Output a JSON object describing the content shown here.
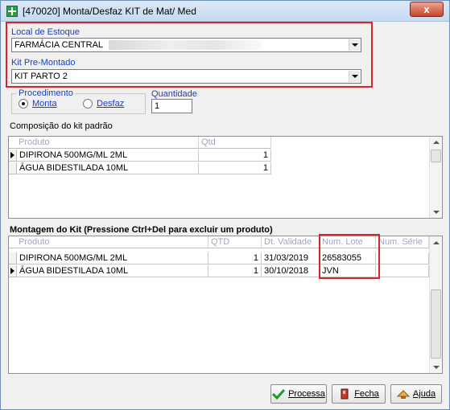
{
  "window": {
    "title": "[470020]  Monta/Desfaz KIT de Mat/ Med",
    "close_label": "x"
  },
  "form": {
    "local_estoque_label": "Local de Estoque",
    "local_estoque_value": "FARMÁCIA CENTRAL",
    "kit_label": "Kit Pre-Montado",
    "kit_value": "KIT PARTO 2",
    "procedimento_label": "Procedimento",
    "radio_monta": "Monta",
    "radio_desfaz": "Desfaz",
    "selected_procedimento": "Monta",
    "quantidade_label": "Quantidade",
    "quantidade_value": "1"
  },
  "composicao": {
    "title": "Composição do kit padrão",
    "columns": [
      "Produto",
      "Qtd"
    ],
    "rows": [
      {
        "produto": "DIPIRONA 500MG/ML 2ML",
        "qtd": "1"
      },
      {
        "produto": "ÁGUA BIDESTILADA 10ML",
        "qtd": "1"
      }
    ]
  },
  "montagem": {
    "title": "Montagem do Kit (Pressione Ctrl+Del para excluir um produto)",
    "columns": [
      "Produto",
      "QTD",
      "Dt. Validade",
      "Num. Lote",
      "Num. Série"
    ],
    "rows": [
      {
        "produto": "DIPIRONA 500MG/ML 2ML",
        "qtd": "1",
        "validade": "31/03/2019",
        "lote": "26583055",
        "serie": ""
      },
      {
        "produto": "ÁGUA BIDESTILADA 10ML",
        "qtd": "1",
        "validade": "30/10/2018",
        "lote": "JVN",
        "serie": ""
      }
    ]
  },
  "buttons": {
    "processa": "Processa",
    "fecha": "Fecha",
    "ajuda": "Ajuda"
  },
  "colors": {
    "highlight": "#d8242b",
    "label_blue": "#1a3fbd",
    "header_text": "#9fa6c6"
  }
}
